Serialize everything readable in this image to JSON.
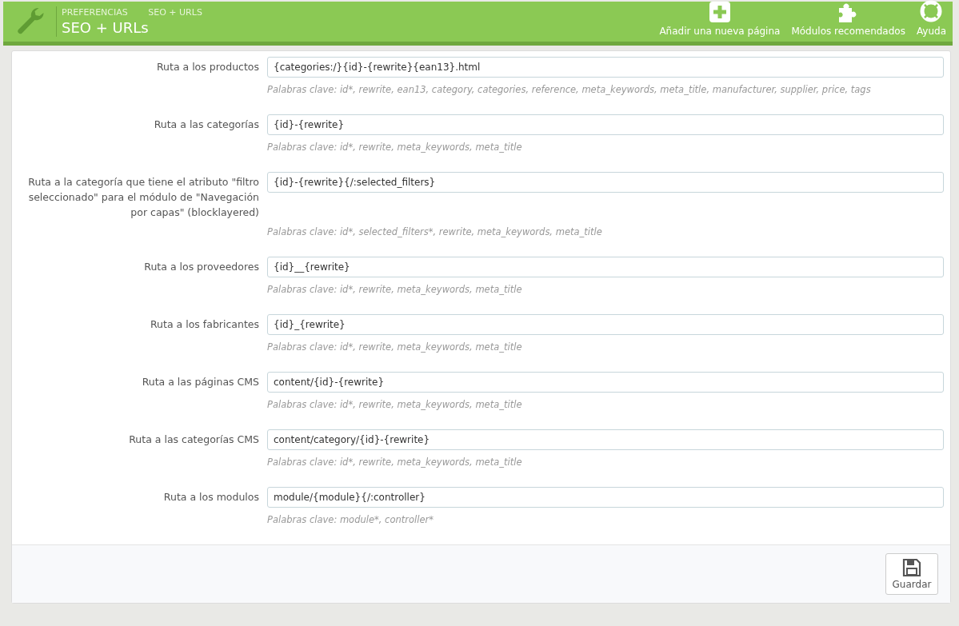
{
  "header": {
    "breadcrumb": [
      "PREFERENCIAS",
      "SEO + URLS"
    ],
    "title": "SEO + URLs",
    "toolbar": [
      {
        "kind": "add",
        "label": "Añadir una nueva página"
      },
      {
        "kind": "modules",
        "label": "Módulos recomendados"
      },
      {
        "kind": "help",
        "label": "Ayuda"
      }
    ]
  },
  "routes": [
    {
      "label": "Ruta a los productos",
      "value": "{categories:/}{id}-{rewrite}{ean13}.html",
      "hint": "Palabras clave: id*, rewrite, ean13, category, categories, reference, meta_keywords, meta_title, manufacturer, supplier, price, tags"
    },
    {
      "label": "Ruta a las categorías",
      "value": "{id}-{rewrite}",
      "hint": "Palabras clave: id*, rewrite, meta_keywords, meta_title"
    },
    {
      "label": "Ruta a la categoría que tiene el atributo \"filtro seleccionado\" para el módulo de \"Navegación por capas\" (blocklayered)",
      "value": "{id}-{rewrite}{/:selected_filters}",
      "hint": "Palabras clave: id*, selected_filters*, rewrite, meta_keywords, meta_title"
    },
    {
      "label": "Ruta a los proveedores",
      "value": "{id}__{rewrite}",
      "hint": "Palabras clave: id*, rewrite, meta_keywords, meta_title"
    },
    {
      "label": "Ruta a los fabricantes",
      "value": "{id}_{rewrite}",
      "hint": "Palabras clave: id*, rewrite, meta_keywords, meta_title"
    },
    {
      "label": "Ruta a las páginas CMS",
      "value": "content/{id}-{rewrite}",
      "hint": "Palabras clave: id*, rewrite, meta_keywords, meta_title"
    },
    {
      "label": "Ruta a las categorías CMS",
      "value": "content/category/{id}-{rewrite}",
      "hint": "Palabras clave: id*, rewrite, meta_keywords, meta_title"
    },
    {
      "label": "Ruta a los modulos",
      "value": "module/{module}{/:controller}",
      "hint": "Palabras clave: module*, controller*"
    }
  ],
  "footer": {
    "save_button": "Guardar"
  }
}
